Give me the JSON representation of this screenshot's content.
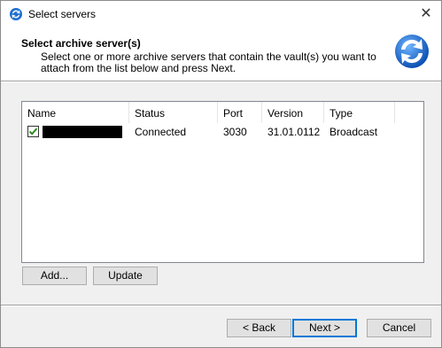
{
  "window": {
    "title": "Select servers",
    "close_glyph": "✕",
    "app_icon": "refresh-arrows-icon"
  },
  "header": {
    "title": "Select archive server(s)",
    "description": "Select one or more archive servers that contain the vault(s) you want to attach from the list below and press Next.",
    "icon": "refresh-arrows-icon"
  },
  "server_list": {
    "columns": [
      "Name",
      "Status",
      "Port",
      "Version",
      "Type"
    ],
    "rows": [
      {
        "checked": true,
        "name_redacted": true,
        "status": "Connected",
        "port": "3030",
        "version": "31.01.0112",
        "type": "Broadcast"
      }
    ]
  },
  "list_buttons": {
    "add": "Add...",
    "update": "Update"
  },
  "footer_buttons": {
    "back": "< Back",
    "next": "Next >",
    "cancel": "Cancel"
  },
  "colors": {
    "accent": "#0078d7",
    "check": "#2e8b22",
    "dialog_bg": "#f0f0f0"
  }
}
